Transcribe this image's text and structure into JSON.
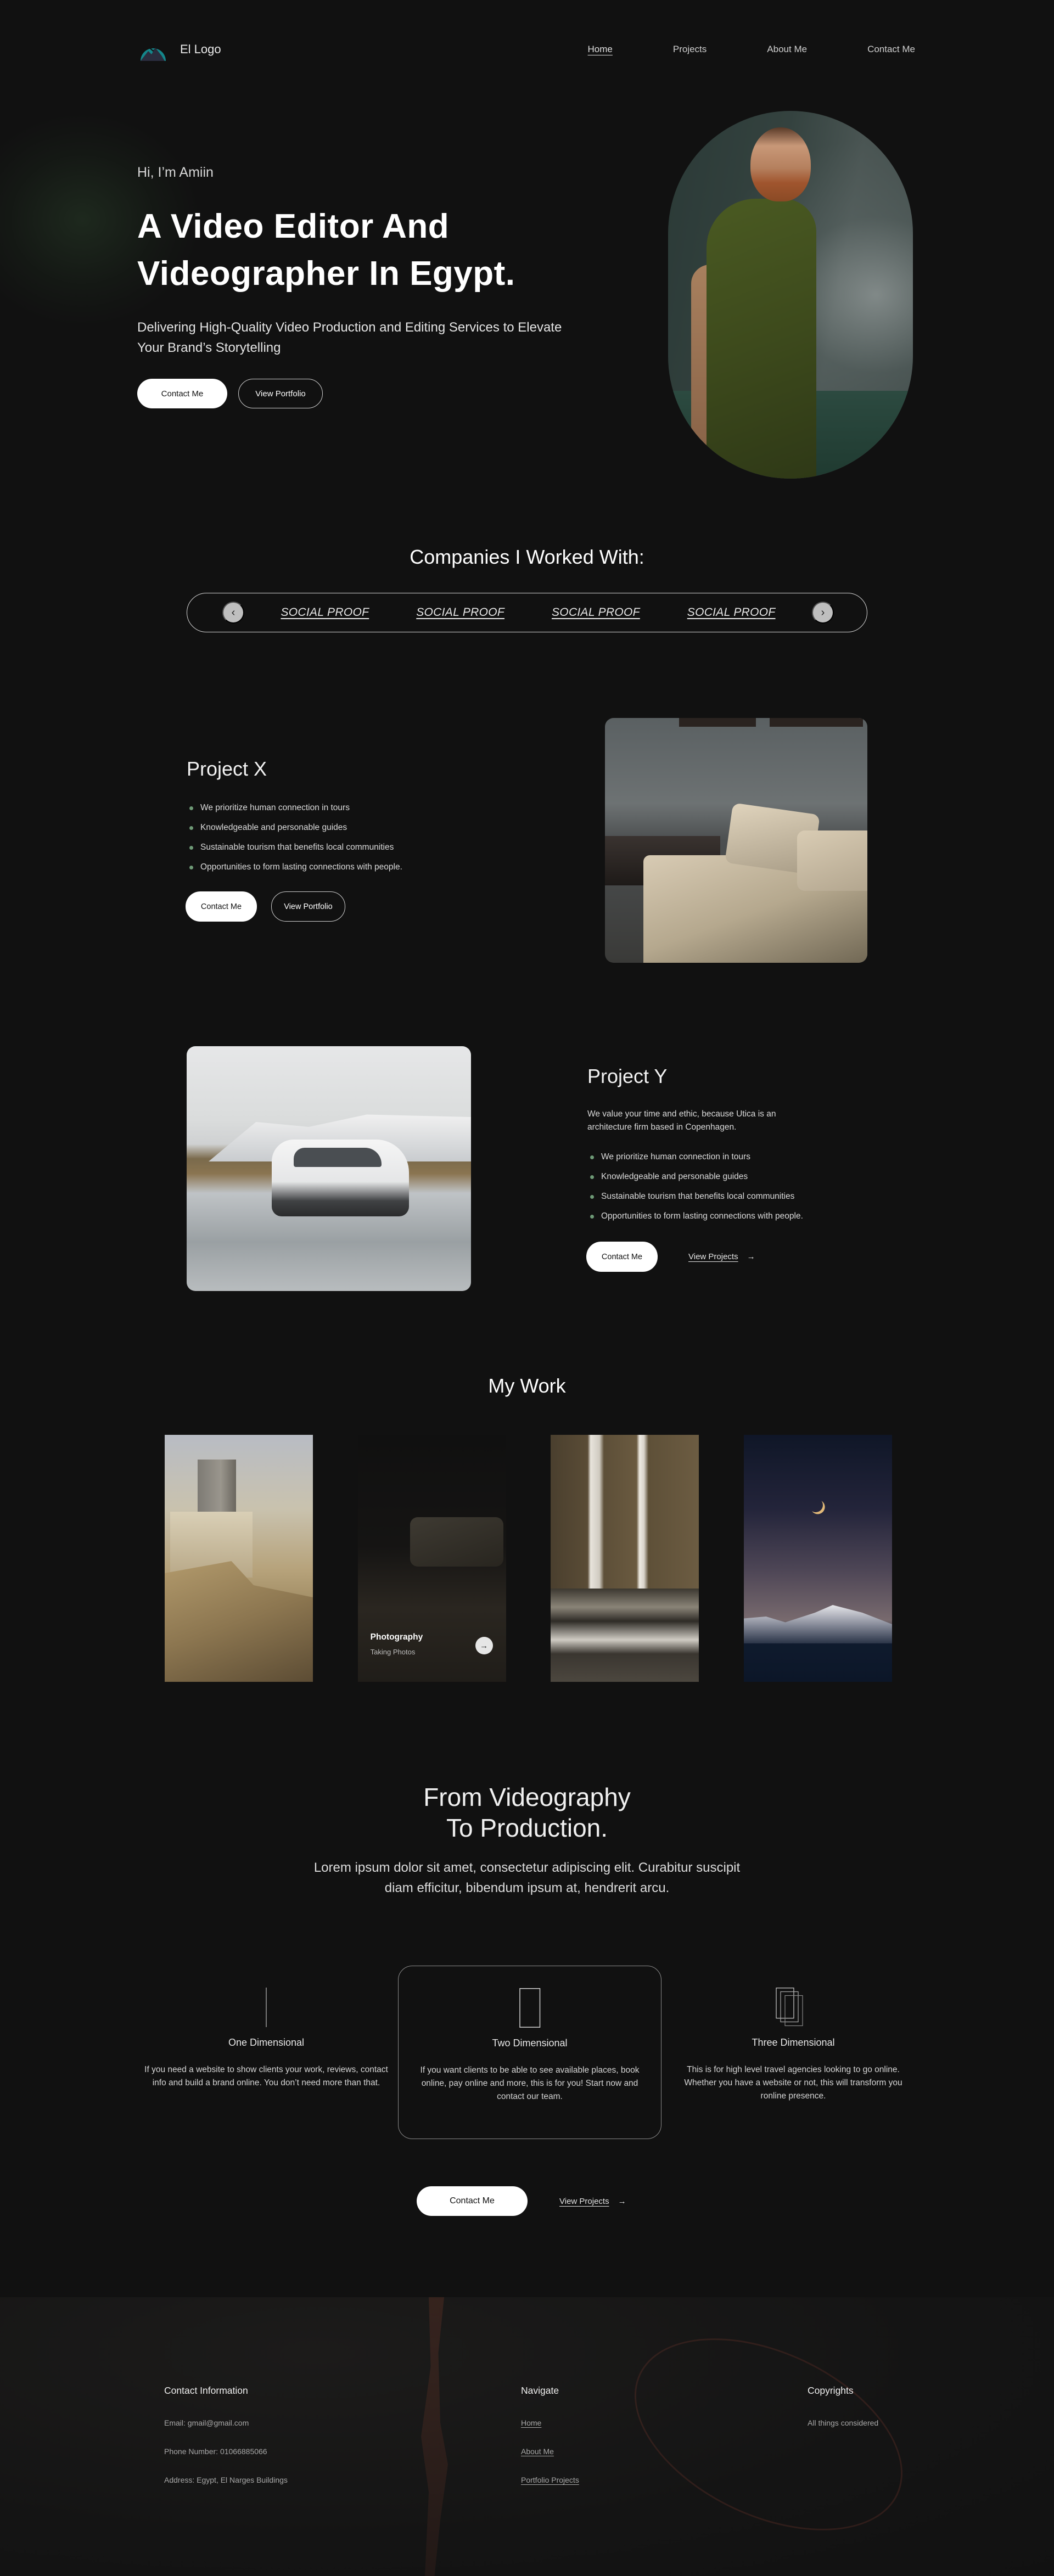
{
  "nav": {
    "logo_text": "El Logo",
    "links": [
      {
        "label": "Home",
        "active": true
      },
      {
        "label": "Projects",
        "active": false
      },
      {
        "label": "About Me",
        "active": false
      },
      {
        "label": "Contact Me",
        "active": false
      }
    ]
  },
  "hero": {
    "greeting": "Hi, I’m Amiin",
    "title": "A Video Editor And Videographer In Egypt.",
    "subtitle": "Delivering High-Quality Video Production and Editing Services to Elevate Your Brand’s Storytelling",
    "primary_button": "Contact Me",
    "secondary_button": "View Portfolio"
  },
  "companies": {
    "heading": "Companies I Worked With:",
    "prev_icon": "chevron-left-icon",
    "next_icon": "chevron-right-icon",
    "items": [
      "SOCIAL PROOF",
      "SOCIAL PROOF",
      "SOCIAL PROOF",
      "SOCIAL PROOF"
    ]
  },
  "project_x": {
    "title": "Project X",
    "bullets": [
      "We prioritize human connection in tours",
      "Knowledgeable and personable guides",
      "Sustainable tourism that benefits local communities",
      "Opportunities to form lasting connections with people."
    ],
    "primary_button": "Contact Me",
    "secondary_button": "View Portfolio"
  },
  "project_y": {
    "title": "Project Y",
    "description": "We value your time and ethic, because Utica is an architecture firm based in Copenhagen.",
    "bullets": [
      "We prioritize human connection in tours",
      "Knowledgeable and personable guides",
      "Sustainable tourism that benefits local communities",
      "Opportunities to form lasting connections with people."
    ],
    "primary_button": "Contact Me",
    "link_label": "View Projects",
    "link_arrow": "→"
  },
  "my_work": {
    "heading": "My Work",
    "cards": [
      {
        "image": "castle-painting"
      },
      {
        "image": "dark-bedroom",
        "caption_title": "Photography",
        "caption_sub": "Taking Photos",
        "arrow": "→"
      },
      {
        "image": "sunlit-hallway"
      },
      {
        "image": "moon-over-mountain"
      }
    ]
  },
  "services": {
    "heading_line1": "From Videography",
    "heading_line2": "To Production.",
    "subtitle": "Lorem ipsum dolor sit amet, consectetur adipiscing elit. Curabitur suscipit diam efficitur, bibendum ipsum at, hendrerit arcu.",
    "cards": [
      {
        "title": "One Dimensional",
        "description": "If you need a website to show clients your work, reviews, contact info and build a brand online. You don’t need more than that.",
        "icon": "line-icon"
      },
      {
        "title": "Two Dimensional",
        "description": "If you want clients to be able to see available places, book online, pay online and more, this is for you! Start now and contact our team.",
        "icon": "rectangle-icon",
        "highlighted": true
      },
      {
        "title": "Three Dimensional",
        "description": "This is for high level travel agencies looking to go online. Whether you have a website or not, this will transform you ronline presence.",
        "icon": "stacked-rectangles-icon"
      }
    ],
    "primary_button": "Contact Me",
    "link_label": "View Projects",
    "link_arrow": "→"
  },
  "footer": {
    "contact": {
      "heading": "Contact Information",
      "email": "Email: gmail@gmail.com",
      "phone": "Phone Number: 01066885066",
      "address": "Address: Egypt, El Narges Buildings"
    },
    "navigate": {
      "heading": "Navigate",
      "links": [
        "Home",
        "About Me",
        "Portfolio Projects"
      ]
    },
    "copyrights": {
      "heading": "Copyrights",
      "text": "All things considered"
    }
  },
  "colors": {
    "background": "#111111",
    "logo_teal": "#14868a",
    "bullet_green": "#6e9a76"
  }
}
